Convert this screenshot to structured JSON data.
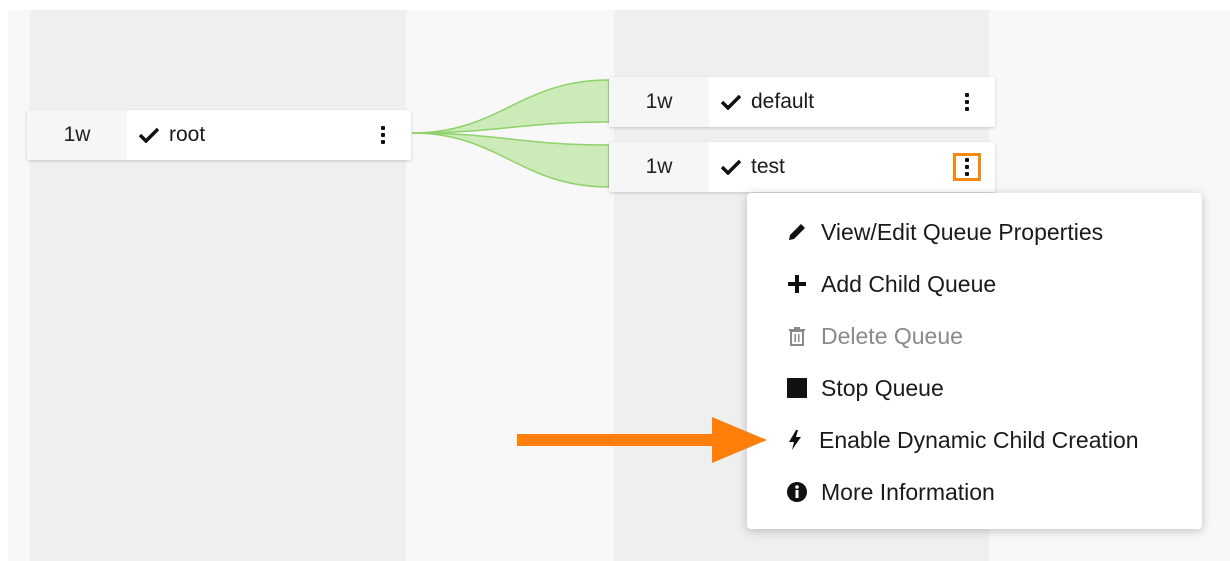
{
  "queues": {
    "root": {
      "weight": "1w",
      "name": "root"
    },
    "default": {
      "weight": "1w",
      "name": "default"
    },
    "test": {
      "weight": "1w",
      "name": "test"
    }
  },
  "menu": {
    "items": [
      {
        "label": "View/Edit Queue Properties",
        "icon": "pencil-icon",
        "enabled": true
      },
      {
        "label": "Add Child Queue",
        "icon": "plus-icon",
        "enabled": true
      },
      {
        "label": "Delete Queue",
        "icon": "trash-icon",
        "enabled": false
      },
      {
        "label": "Stop Queue",
        "icon": "stop-icon",
        "enabled": true
      },
      {
        "label": "Enable Dynamic Child Creation",
        "icon": "bolt-icon",
        "enabled": true
      },
      {
        "label": "More Information",
        "icon": "info-icon",
        "enabled": true
      }
    ]
  },
  "colors": {
    "connector": "#8fd16a",
    "highlight": "#f28a12",
    "arrow": "#ff7f0a"
  }
}
